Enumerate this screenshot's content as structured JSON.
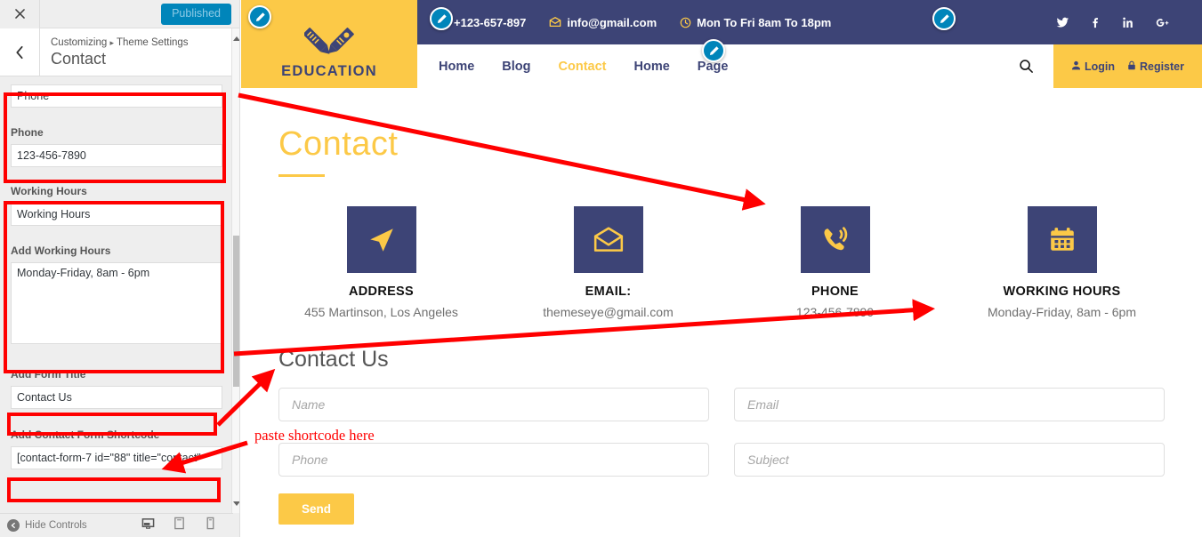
{
  "customizer": {
    "close_icon": "close-icon",
    "publish_button": "Published",
    "back_icon": "chevron-left-icon",
    "breadcrumb_root": "Customizing",
    "breadcrumb_sep": "▸",
    "breadcrumb_section": "Theme Settings",
    "panel_title": "Contact",
    "fields": [
      {
        "label": "",
        "value": "Phone",
        "type": "text",
        "name": "phone-label-input"
      },
      {
        "label": "Phone",
        "value": "123-456-7890",
        "type": "text",
        "name": "phone-value-input"
      },
      {
        "label": "Working Hours",
        "value": "Working Hours",
        "type": "text",
        "name": "working-hours-label-input"
      },
      {
        "label": "Add Working Hours",
        "value": "Monday-Friday, 8am - 6pm",
        "type": "textarea",
        "name": "working-hours-value-textarea"
      },
      {
        "label": "Add Form Title",
        "value": "Contact Us",
        "type": "text",
        "name": "form-title-input"
      },
      {
        "label": "Add Contact Form Shortcode",
        "value": "[contact-form-7 id=\"88\" title=\"contact\"",
        "type": "text",
        "name": "shortcode-input"
      }
    ],
    "footer": {
      "hide_controls": "Hide Controls",
      "hide_icon": "collapse-icon",
      "devices": [
        "desktop-icon",
        "tablet-icon",
        "mobile-icon"
      ]
    }
  },
  "preview": {
    "topbar": {
      "phone": "+123-657-897",
      "phone_icon": "phone-icon",
      "email": "info@gmail.com",
      "email_icon": "envelope-icon",
      "hours": "Mon To Fri 8am To 18pm",
      "hours_icon": "clock-icon",
      "socials": [
        "twitter-icon",
        "facebook-icon",
        "linkedin-icon",
        "googleplus-icon"
      ]
    },
    "logo": {
      "text": "EDUCATION",
      "icon": "ruler-pencil-icon"
    },
    "nav": {
      "items": [
        {
          "label": "Home",
          "active": false
        },
        {
          "label": "Blog",
          "active": false
        },
        {
          "label": "Contact",
          "active": true
        },
        {
          "label": "Home",
          "active": false
        },
        {
          "label": "Page",
          "active": false
        }
      ],
      "search_icon": "search-icon",
      "login": "Login",
      "login_icon": "user-icon",
      "register": "Register",
      "register_icon": "lock-icon"
    },
    "page_title": "Contact",
    "info_cards": [
      {
        "icon": "location-arrow-icon",
        "title": "ADDRESS",
        "value": "455 Martinson, Los Angeles"
      },
      {
        "icon": "open-envelope-icon",
        "title": "EMAIL:",
        "value": "themeseye@gmail.com"
      },
      {
        "icon": "phone-ringing-icon",
        "title": "PHONE",
        "value": "123-456-7890"
      },
      {
        "icon": "calendar-icon",
        "title": "WORKING HOURS",
        "value": "Monday-Friday, 8am - 6pm"
      }
    ],
    "form": {
      "title": "Contact Us",
      "name_placeholder": "Name",
      "email_placeholder": "Email",
      "phone_placeholder": "Phone",
      "subject_placeholder": "Subject",
      "submit_label": "Send"
    },
    "edit_pencils": 4
  },
  "annotations": {
    "note": "paste shortcode here",
    "color": "#ff0000"
  }
}
